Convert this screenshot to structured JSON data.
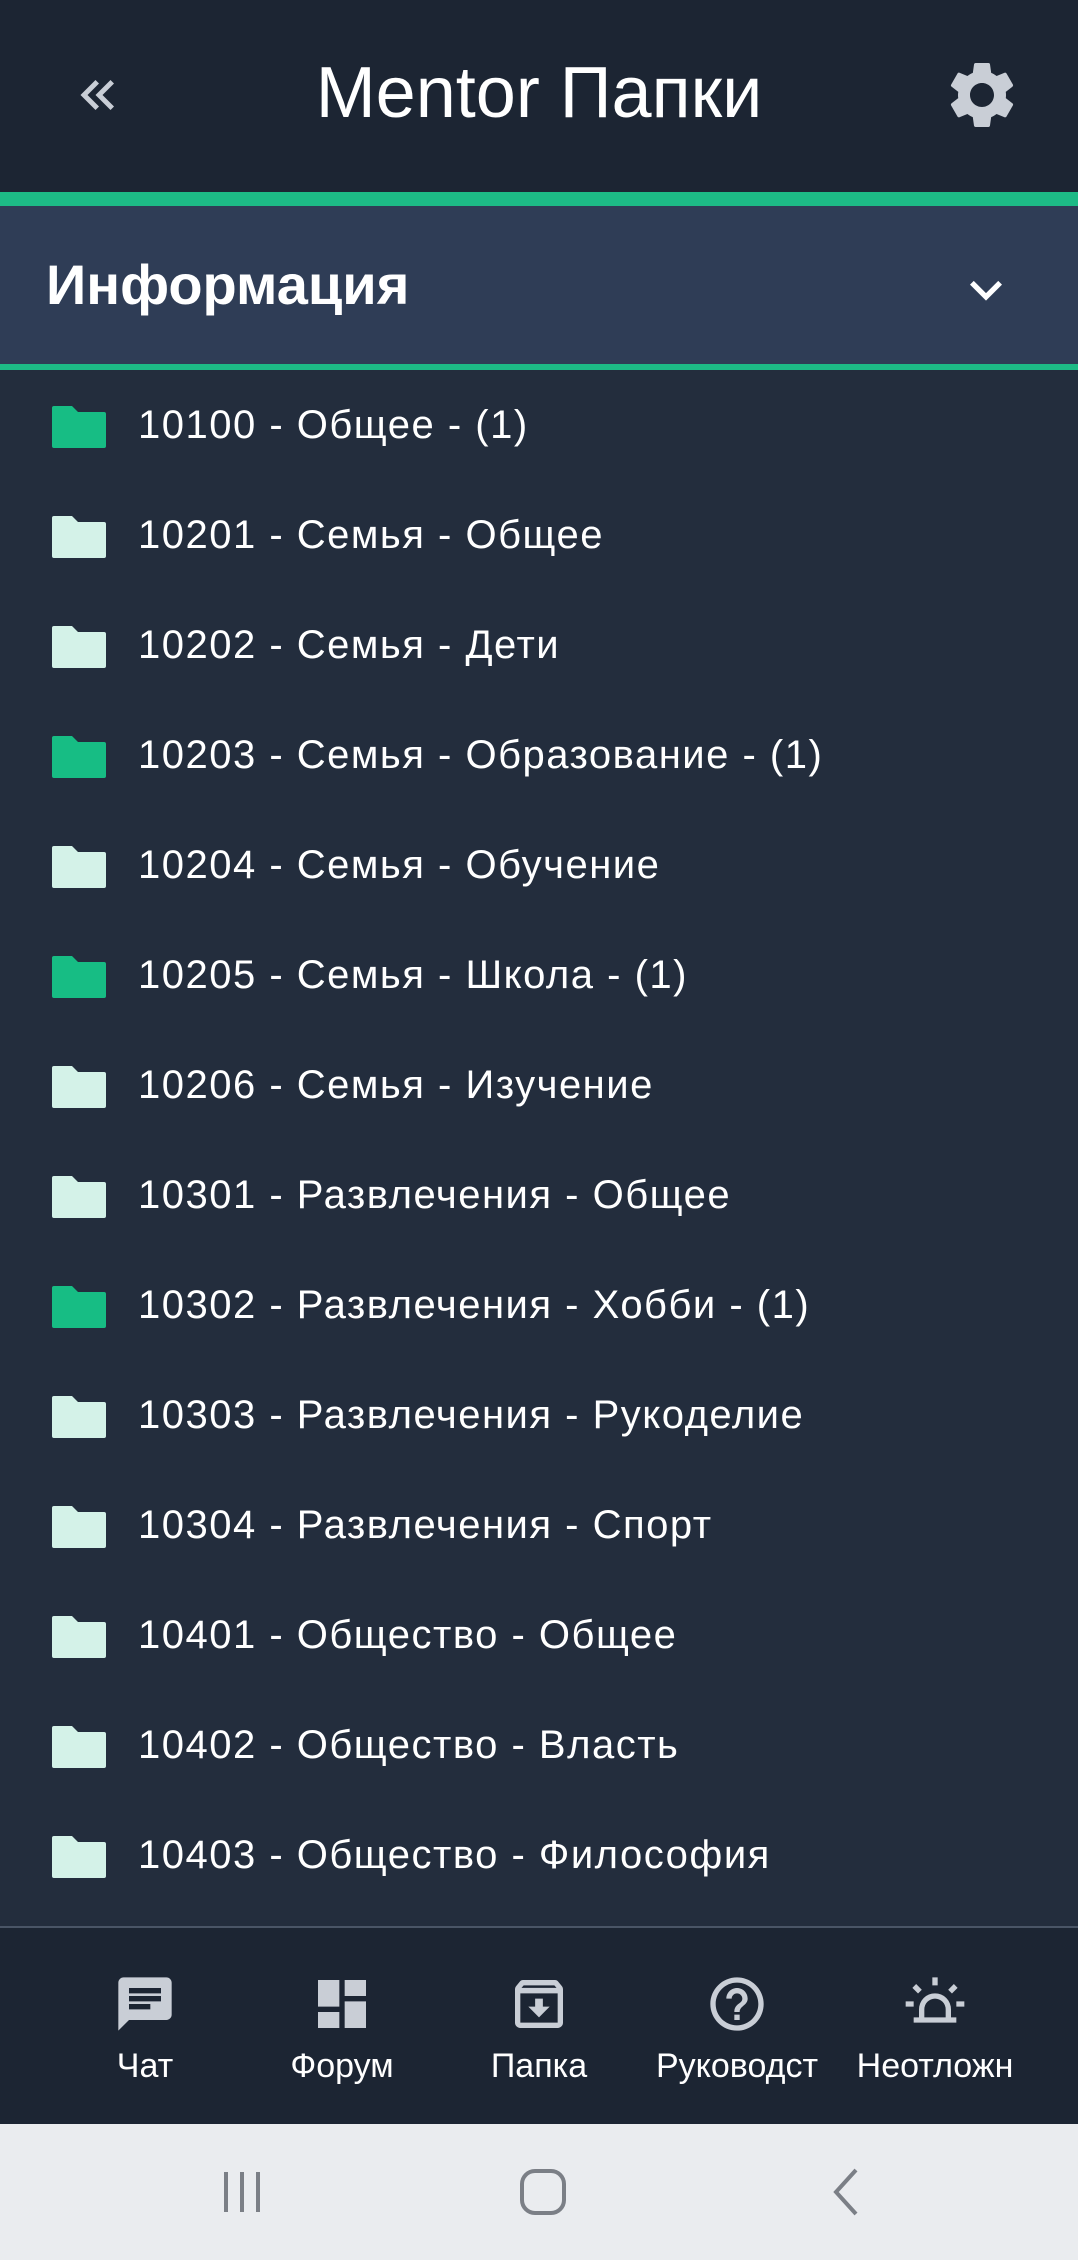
{
  "header": {
    "title": "Mentor Папки",
    "back_icon": "double-chevron-left-icon",
    "settings_icon": "gear-icon"
  },
  "section": {
    "label": "Информация",
    "toggle_icon": "chevron-down-icon"
  },
  "colors": {
    "accent": "#1dbb86",
    "folder_filled": "#17bd84",
    "folder_empty": "#d4f2e8",
    "header_bg": "#1c2533",
    "page_bg": "#232d3d",
    "section_bg": "#2f3d56"
  },
  "folders": [
    {
      "label": "10100 - Общее - (1)",
      "has_items": true
    },
    {
      "label": "10201 - Семья - Общее",
      "has_items": false
    },
    {
      "label": "10202 - Семья - Дети",
      "has_items": false
    },
    {
      "label": "10203 - Семья - Образование - (1)",
      "has_items": true
    },
    {
      "label": "10204 - Семья - Обучение",
      "has_items": false
    },
    {
      "label": "10205 - Семья - Школа - (1)",
      "has_items": true
    },
    {
      "label": "10206 - Семья - Изучение",
      "has_items": false
    },
    {
      "label": "10301 - Развлечения - Общее",
      "has_items": false
    },
    {
      "label": "10302 - Развлечения - Хобби - (1)",
      "has_items": true
    },
    {
      "label": "10303 - Развлечения - Рукоделие",
      "has_items": false
    },
    {
      "label": "10304 - Развлечения - Спорт",
      "has_items": false
    },
    {
      "label": "10401 - Общество - Общее",
      "has_items": false
    },
    {
      "label": "10402 - Общество - Власть",
      "has_items": false
    },
    {
      "label": "10403 - Общество - Философия",
      "has_items": false
    }
  ],
  "bottom_nav": [
    {
      "label": "Чат",
      "icon": "chat-icon"
    },
    {
      "label": "Форум",
      "icon": "dashboard-icon"
    },
    {
      "label": "Папка",
      "icon": "archive-icon"
    },
    {
      "label": "Руководст",
      "icon": "help-icon"
    },
    {
      "label": "Неотложн",
      "icon": "alarm-light-icon"
    }
  ],
  "system_nav": {
    "recents_icon": "recents-icon",
    "home_icon": "home-icon",
    "back_icon": "back-icon"
  }
}
